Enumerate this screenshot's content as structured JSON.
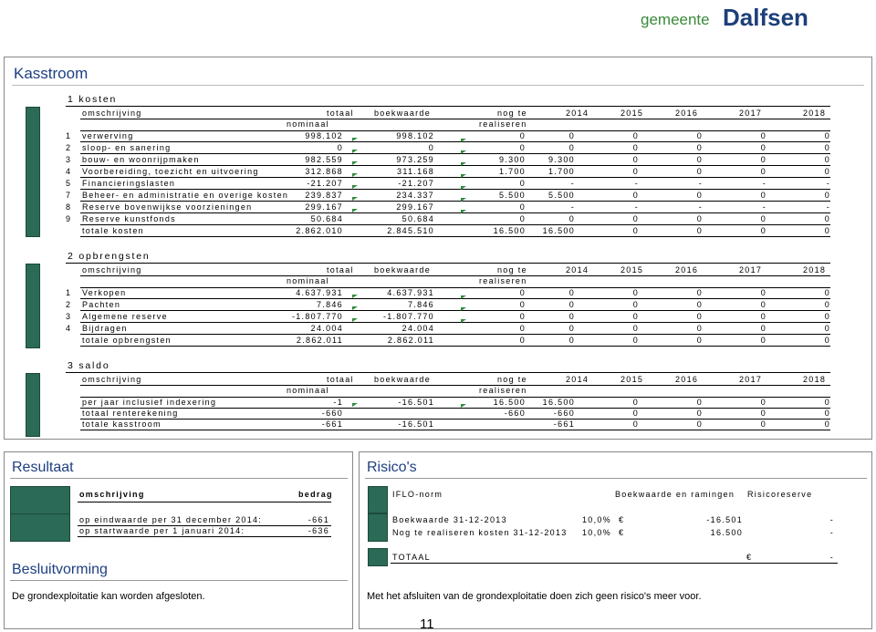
{
  "logo": {
    "small": "gemeente",
    "big": "Dalfsen"
  },
  "kasstroom": {
    "title": "Kasstroom",
    "columns": {
      "omschrijving": "omschrijving",
      "totaal_nominaal": [
        "totaal",
        "nominaal"
      ],
      "boekwaarde": "boekwaarde",
      "nog_te_realiseren": [
        "nog te",
        "realiseren"
      ],
      "years": [
        "2014",
        "2015",
        "2016",
        "2017",
        "2018"
      ]
    },
    "kosten": {
      "title": "1 kosten",
      "rows": [
        {
          "nr": "1",
          "label": "verwerving",
          "totaal": "998.102",
          "boek": "998.102",
          "nog": "0",
          "y": [
            "0",
            "0",
            "0",
            "0",
            "0"
          ]
        },
        {
          "nr": "2",
          "label": "sloop- en sanering",
          "totaal": "0",
          "boek": "0",
          "nog": "0",
          "y": [
            "0",
            "0",
            "0",
            "0",
            "0"
          ]
        },
        {
          "nr": "3",
          "label": "bouw- en woonrijpmaken",
          "totaal": "982.559",
          "boek": "973.259",
          "nog": "9.300",
          "y": [
            "9.300",
            "0",
            "0",
            "0",
            "0"
          ]
        },
        {
          "nr": "4",
          "label": "Voorbereiding, toezicht en uitvoering",
          "totaal": "312.868",
          "boek": "311.168",
          "nog": "1.700",
          "y": [
            "1.700",
            "0",
            "0",
            "0",
            "0"
          ]
        },
        {
          "nr": "5",
          "label": "Financieringslasten",
          "totaal": "-21.207",
          "boek": "-21.207",
          "nog": "0",
          "y": [
            "-",
            "-",
            "-",
            "-",
            "-"
          ]
        },
        {
          "nr": "7",
          "label": "Beheer- en administratie en overige kosten",
          "totaal": "239.837",
          "boek": "234.337",
          "nog": "5.500",
          "y": [
            "5.500",
            "0",
            "0",
            "0",
            "0"
          ]
        },
        {
          "nr": "8",
          "label": "Reserve bovenwijkse voorzieningen",
          "totaal": "299.167",
          "boek": "299.167",
          "nog": "0",
          "y": [
            "-",
            "-",
            "-",
            "-",
            "-"
          ]
        },
        {
          "nr": "9",
          "label": "Reserve kunstfonds",
          "totaal": "50.684",
          "boek": "50.684",
          "nog": "0",
          "y": [
            "0",
            "0",
            "0",
            "0",
            "0"
          ]
        }
      ],
      "total": {
        "label": "totale kosten",
        "totaal": "2.862.010",
        "boek": "2.845.510",
        "nog": "16.500",
        "y": [
          "16.500",
          "0",
          "0",
          "0",
          "0"
        ]
      }
    },
    "opbrengsten": {
      "title": "2 opbrengsten",
      "rows": [
        {
          "nr": "1",
          "label": "Verkopen",
          "totaal": "4.637.931",
          "boek": "4.637.931",
          "nog": "0",
          "y": [
            "0",
            "0",
            "0",
            "0",
            "0"
          ]
        },
        {
          "nr": "2",
          "label": "Pachten",
          "totaal": "7.846",
          "boek": "7.846",
          "nog": "0",
          "y": [
            "0",
            "0",
            "0",
            "0",
            "0"
          ]
        },
        {
          "nr": "3",
          "label": "Algemene reserve",
          "totaal": "-1.807.770",
          "boek": "-1.807.770",
          "nog": "0",
          "y": [
            "0",
            "0",
            "0",
            "0",
            "0"
          ]
        },
        {
          "nr": "4",
          "label": "Bijdragen",
          "totaal": "24.004",
          "boek": "24.004",
          "nog": "0",
          "y": [
            "0",
            "0",
            "0",
            "0",
            "0"
          ]
        }
      ],
      "total": {
        "label": "totale opbrengsten",
        "totaal": "2.862.011",
        "boek": "2.862.011",
        "nog": "0",
        "y": [
          "0",
          "0",
          "0",
          "0",
          "0"
        ]
      }
    },
    "saldo": {
      "title": "3 saldo",
      "rows": [
        {
          "label": "per jaar inclusief indexering",
          "totaal": "-1",
          "boek": "-16.501",
          "nog": "16.500",
          "y": [
            "16.500",
            "0",
            "0",
            "0",
            "0"
          ]
        },
        {
          "label": "totaal renterekening",
          "totaal": "-660",
          "boek": "",
          "nog": "-660",
          "y": [
            "-660",
            "0",
            "0",
            "0",
            "0"
          ]
        },
        {
          "label": "totale kasstroom",
          "totaal": "-661",
          "boek": "-16.501",
          "nog": "",
          "y": [
            "-661",
            "0",
            "0",
            "0",
            "0"
          ]
        }
      ]
    }
  },
  "resultaat": {
    "title": "Resultaat",
    "col_omschrijving": "omschrijving",
    "col_bedrag": "bedrag",
    "rows": [
      {
        "label": "op eindwaarde per 31 december 2014:",
        "value": "-661"
      },
      {
        "label": "op startwaarde per 1 januari 2014:",
        "value": "-636"
      }
    ]
  },
  "risicos": {
    "title": "Risico's",
    "col_iflo": "IFLO-norm",
    "col_boek": "Boekwaarde en ramingen",
    "col_risico": "Risicoreserve",
    "rows": [
      {
        "label": "Boekwaarde 31-12-2013",
        "pct": "10,0%",
        "euro": "€",
        "value": "-16.501",
        "risico": "-"
      },
      {
        "label": "Nog te realiseren kosten 31-12-2013",
        "pct": "10,0%",
        "euro": "€",
        "value": "16.500",
        "risico": "-"
      }
    ],
    "total_label": "TOTAAL",
    "total_euro": "€",
    "total_value": "-"
  },
  "besluitvorming": {
    "title": "Besluitvorming",
    "text": "De grondexploitatie kan worden afgesloten."
  },
  "risico_text": "Met het afsluiten van de grondexploitatie doen zich geen risico's meer voor.",
  "page_number": "11"
}
